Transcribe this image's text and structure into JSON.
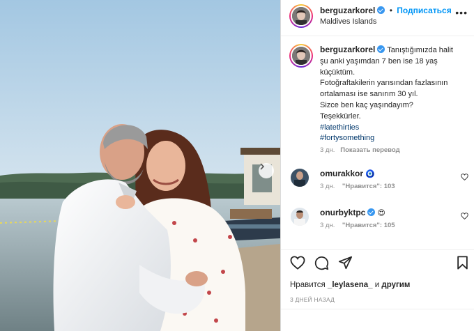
{
  "post": {
    "author": "berguzarkorel",
    "separator": "•",
    "follow_label": "Подписаться",
    "location": "Maldives Islands",
    "more_label": "•••"
  },
  "caption": {
    "lines": [
      "Tanıştığımızda halit",
      "şu anki yaşımdan 7 ben ise 18 yaş",
      "küçüktüm.",
      "Fotoğraftakilerin yarısından fazlasının",
      "ortalaması ise sanırım 30 yıl.",
      "Sizce ben kaç yaşındayım?",
      "Teşekkürler."
    ],
    "hashtags": [
      "#latethirties",
      "#fortysomething"
    ],
    "time": "3 дн.",
    "translate_label": "Показать перевод"
  },
  "comments": [
    {
      "user": "omurakkor",
      "emoji": "🧿",
      "time": "3 дн.",
      "likes": "\"Нравится\": 103"
    },
    {
      "user": "onurbyktpc",
      "emoji": "😍",
      "time": "3 дн.",
      "likes": "\"Нравится\": 105"
    }
  ],
  "footer": {
    "liked_prefix": "Нравится",
    "liked_user": "_leylasena_",
    "liked_and": "и",
    "liked_others": "другим",
    "ago": "3 ДНЕЙ НАЗАД"
  },
  "icons": {
    "like": "heart-icon",
    "comment": "comment-icon",
    "share": "share-icon",
    "save": "bookmark-icon",
    "next": "chevron-right-icon",
    "more": "more-horizontal-icon"
  },
  "colors": {
    "accent": "#0095f6",
    "verified": "#3897f0",
    "hashtag": "#00376b",
    "muted": "#8e8e8e"
  }
}
